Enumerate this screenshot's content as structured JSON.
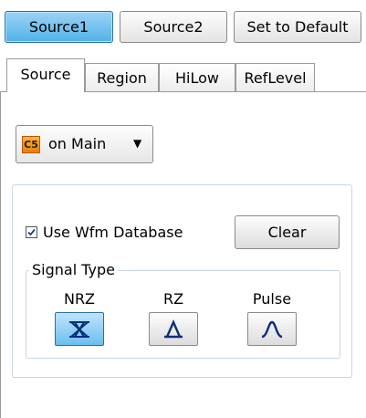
{
  "top_buttons": {
    "source1": "Source1",
    "source2": "Source2",
    "set_default": "Set to Default"
  },
  "tabs": {
    "source": "Source",
    "region": "Region",
    "hilow": "HiLow",
    "reflevel": "RefLevel"
  },
  "dropdown": {
    "badge": "C5",
    "label": "on Main",
    "arrow": "▼"
  },
  "wfm": {
    "checkbox_label": "Use Wfm Database",
    "checked": true,
    "clear_label": "Clear"
  },
  "signal_type": {
    "legend": "Signal Type",
    "options": {
      "nrz": "NRZ",
      "rz": "RZ",
      "pulse": "Pulse"
    },
    "selected": "NRZ"
  },
  "colors": {
    "accent": "#52b1e8",
    "badge": "#f07c00",
    "icon": "#1a3a8a"
  }
}
